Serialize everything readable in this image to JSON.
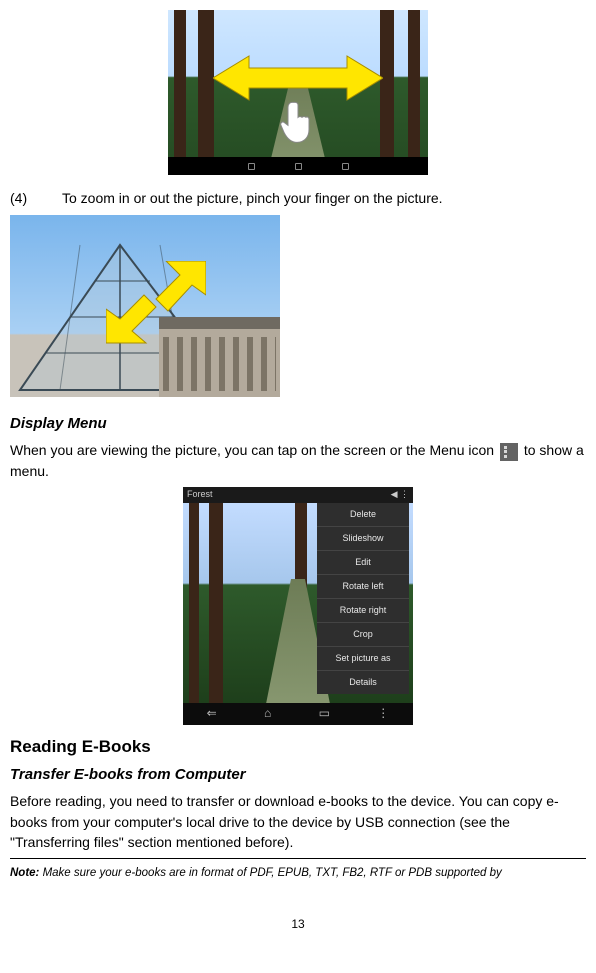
{
  "shot1": {
    "nav_dots": 3
  },
  "step4": {
    "num": "(4)",
    "text": "To zoom in or out the picture, pinch your finger on the picture."
  },
  "display_menu": {
    "heading": "Display Menu",
    "para_before": "When you are viewing the picture, you can tap on the screen or the Menu icon ",
    "para_after": " to show a menu."
  },
  "shot3": {
    "status_left": "Forest",
    "status_icons": "◀  ⋮",
    "menu_items": [
      "Delete",
      "Slideshow",
      "Edit",
      "Rotate left",
      "Rotate right",
      "Crop",
      "Set picture as",
      "Details"
    ],
    "nav_icons": [
      "⇐",
      "⌂",
      "▭",
      "⋮"
    ]
  },
  "reading": {
    "heading": "Reading E-Books",
    "sub_heading": "Transfer E-books from Computer",
    "para": "Before reading, you need to transfer or download e-books to the device. You can copy e-books from your computer's local drive to the device by USB connection (see the \"Transferring files\" section mentioned before)."
  },
  "note": {
    "label": "Note:",
    "text": " Make sure your e-books are in format of PDF, EPUB, TXT, FB2, RTF or PDB supported by"
  },
  "page_num": "13"
}
